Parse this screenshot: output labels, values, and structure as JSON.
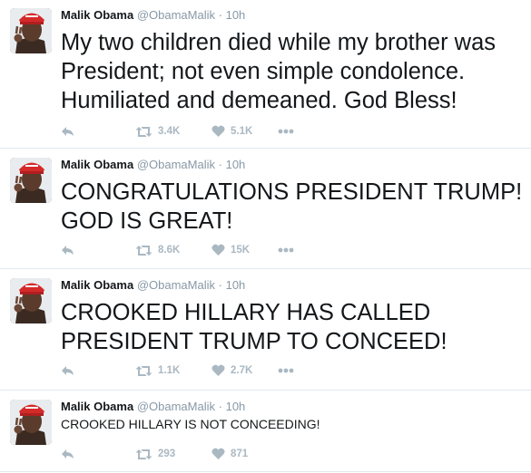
{
  "tweets": [
    {
      "name": "Malik Obama",
      "handle": "@ObamaMalik",
      "separator": "·",
      "time": "10h",
      "text": "My two children died while my brother was President; not even simple condolence. Humiliated and demeaned. God Bless!",
      "retweets": "3.4K",
      "likes": "5.1K"
    },
    {
      "name": "Malik Obama",
      "handle": "@ObamaMalik",
      "separator": "·",
      "time": "10h",
      "text": "CONGRATULATIONS PRESIDENT TRUMP! GOD IS GREAT!",
      "retweets": "8.6K",
      "likes": "15K"
    },
    {
      "name": "Malik Obama",
      "handle": "@ObamaMalik",
      "separator": "·",
      "time": "10h",
      "text": "CROOKED HILLARY HAS CALLED PRESIDENT TRUMP TO CONCEED!",
      "retweets": "1.1K",
      "likes": "2.7K"
    },
    {
      "name": "Malik Obama",
      "handle": "@ObamaMalik",
      "separator": "·",
      "time": "10h",
      "text": "CROOKED HILLARY IS NOT CONCEEDING!",
      "retweets": "293",
      "likes": "871"
    }
  ],
  "icons": {
    "reply": "reply-icon",
    "retweet": "retweet-icon",
    "like": "heart-icon",
    "more": "more-icon"
  },
  "colors": {
    "text": "#14171a",
    "muted": "#8899a6",
    "action": "#aab8c2",
    "divider": "#e1e8ed",
    "hat_red": "#d42a2a"
  }
}
